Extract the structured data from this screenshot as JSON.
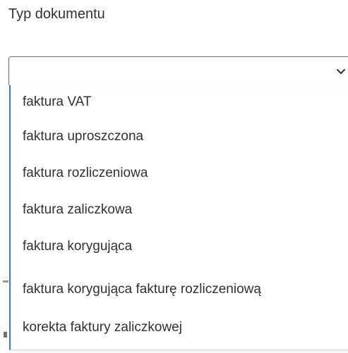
{
  "field": {
    "label": "Typ dokumentu",
    "value": "",
    "icon": "chevron-down-icon"
  },
  "dropdown": {
    "options": [
      "faktura VAT",
      "faktura uproszczona",
      "faktura rozliczeniowa",
      "faktura zaliczkowa",
      "faktura korygująca",
      "faktura korygująca fakturę rozliczeniową",
      "korekta faktury zaliczkowej"
    ]
  },
  "colors": {
    "text": "#323130",
    "select_border": "#6b6b6b",
    "dropdown_accent": "#3b7fc4"
  }
}
